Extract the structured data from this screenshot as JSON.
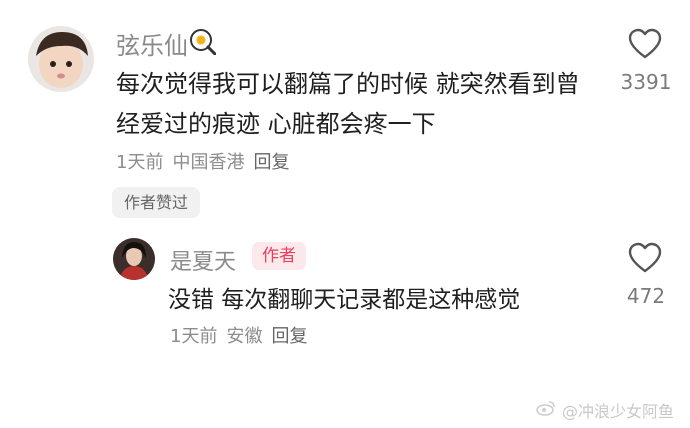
{
  "comments": [
    {
      "username": "弦乐仙",
      "username_icon": "frying-egg-icon",
      "text": "每次觉得我可以翻篇了的时候 就突然看到曾经爱过的痕迹 心脏都会疼一下",
      "time": "1天前",
      "location": "中国香港",
      "reply_label": "回复",
      "like_count": "3391",
      "author_liked_label": "作者赞过"
    },
    {
      "username": "是夏天",
      "badge": "作者",
      "text": "没错 每次翻聊天记录都是这种感觉",
      "time": "1天前",
      "location": "安徽",
      "reply_label": "回复",
      "like_count": "472"
    }
  ],
  "watermark": "@冲浪少女阿鱼",
  "colors": {
    "author_badge_bg": "#fde8ec",
    "author_badge_text": "#e8405d",
    "meta_text": "#8d8d8d",
    "body_text": "#1f1f1f"
  }
}
